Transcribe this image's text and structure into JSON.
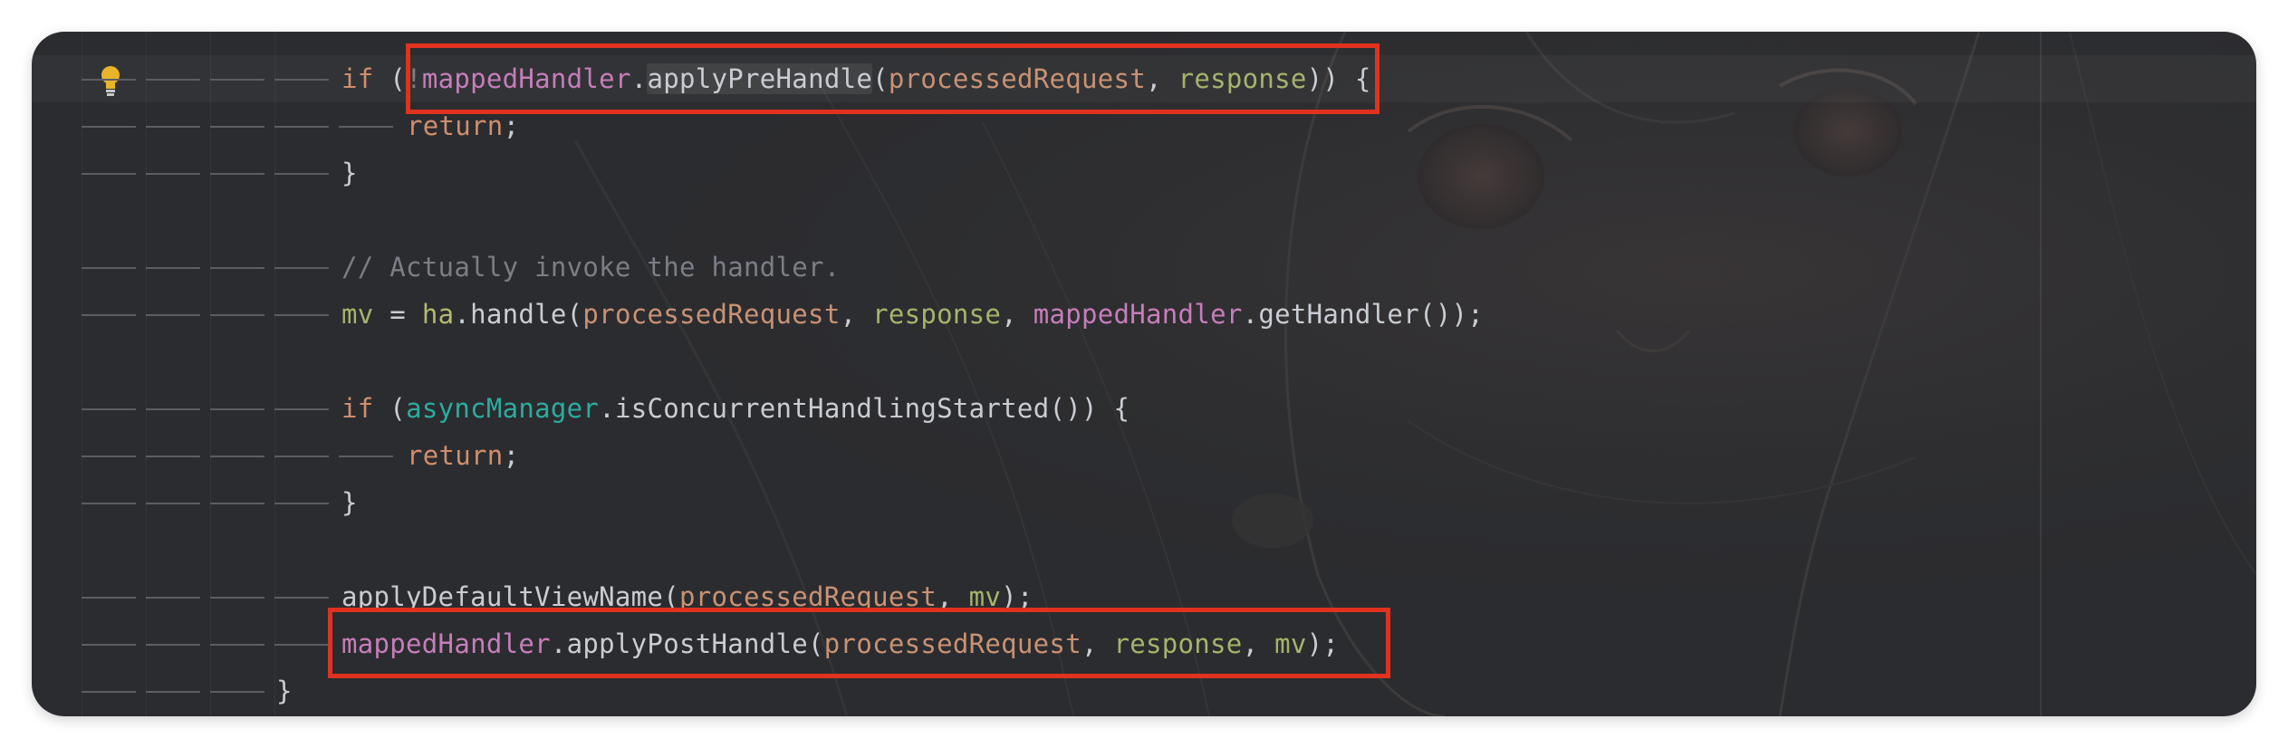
{
  "editor": {
    "lines": [
      {
        "tokens": [
          "if",
          " (",
          "!",
          "mappedHandler",
          ".",
          "applyPreHandle",
          "(",
          "processedRequest",
          ", ",
          "response",
          ")) {"
        ]
      },
      {
        "tokens": [
          "return",
          ";"
        ]
      },
      {
        "tokens": [
          "}"
        ]
      },
      {
        "tokens": []
      },
      {
        "tokens": [
          "// Actually invoke the handler."
        ]
      },
      {
        "tokens": [
          "mv",
          " = ",
          "ha",
          ".handle(",
          "processedRequest",
          ", ",
          "response",
          ", ",
          "mappedHandler",
          ".getHandler());"
        ]
      },
      {
        "tokens": []
      },
      {
        "tokens": [
          "if",
          " (",
          "asyncManager",
          ".isConcurrentHandlingStarted()) {"
        ]
      },
      {
        "tokens": [
          "return",
          ";"
        ]
      },
      {
        "tokens": [
          "}"
        ]
      },
      {
        "tokens": []
      },
      {
        "tokens": [
          "applyDefaultViewName(",
          "processedRequest",
          ", ",
          "mv",
          ");"
        ]
      },
      {
        "tokens": [
          "mappedHandler",
          ".applyPostHandle(",
          "processedRequest",
          ", ",
          "response",
          ", ",
          "mv",
          ");"
        ]
      },
      {
        "tokens": [
          "}"
        ]
      }
    ],
    "highlight_color": "#e0321f",
    "gutter_icon": "lightbulb-icon"
  }
}
